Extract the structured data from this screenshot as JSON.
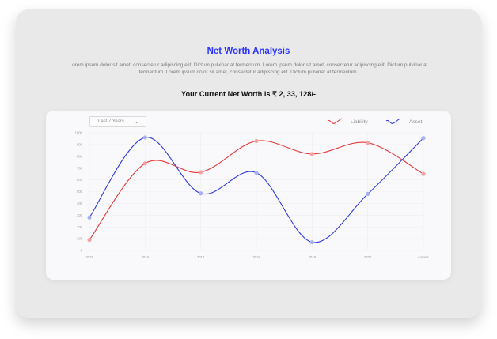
{
  "header": {
    "title": "Net Worth Analysis",
    "description": "Lorem ipsum dolor sit amet, consectetur adipiscing elit. Dictum pulvinar at fermentum. Lorem ipsum dolor sit amet, consectetur adipiscing elit. Dictum pulvinar at fermentum. Lorem ipsum dolor sit amet, consectetur adipiscing elit. Dictum pulvinar at fermentum.",
    "net_worth_text": "Your Current Net Worth is ₹ 2, 33, 128/-"
  },
  "controls": {
    "range_select_value": "Last 7 Years",
    "dropdown_icon": "chevron-down-icon"
  },
  "colors": {
    "title": "#2b34ff",
    "liability": "#e63a3a",
    "asset": "#2d3be0",
    "liability_marker": "#f2a2a2",
    "asset_marker": "#a9b0f4"
  },
  "chart_data": {
    "type": "line",
    "categories": [
      "2015",
      "2016",
      "2017",
      "2018",
      "2019",
      "2020",
      "current"
    ],
    "ylim": [
      0,
      1000
    ],
    "yticks": [
      0,
      100,
      200,
      300,
      400,
      500,
      600,
      700,
      800,
      900,
      1000
    ],
    "grid": true,
    "legend_position": "top-right",
    "series": [
      {
        "name": "Liability",
        "values": [
          90,
          740,
          665,
          930,
          820,
          915,
          650
        ]
      },
      {
        "name": "Asset",
        "values": [
          280,
          960,
          485,
          660,
          70,
          480,
          955
        ]
      }
    ]
  }
}
